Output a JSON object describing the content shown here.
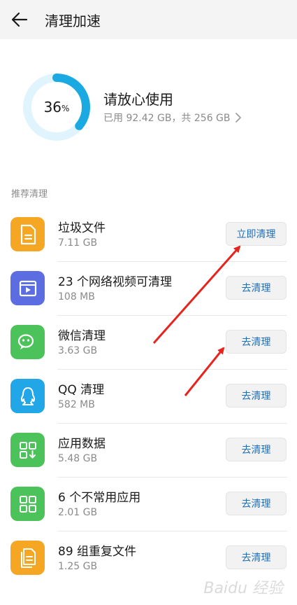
{
  "header": {
    "title": "清理加速"
  },
  "storage": {
    "percent": "36",
    "percent_symbol": "%",
    "usage_fraction": 0.36,
    "status": "请放心使用",
    "detail": "已用 92.42 GB，共 256 GB",
    "ring_color": "#1aa9e0",
    "ring_track_color": "#dff4fc"
  },
  "section": {
    "label": "推荐清理"
  },
  "items": [
    {
      "title": "垃圾文件",
      "size": "7.11 GB",
      "button": "立即清理",
      "icon": "document-icon",
      "color": "#f5a623"
    },
    {
      "title": "23 个网络视频可清理",
      "size": "108 MB",
      "button": "去清理",
      "icon": "video-icon",
      "color": "#5b6de0"
    },
    {
      "title": "微信清理",
      "size": "3.63 GB",
      "button": "去清理",
      "icon": "wechat-icon",
      "color": "#4cc25a"
    },
    {
      "title": "QQ 清理",
      "size": "582 MB",
      "button": "去清理",
      "icon": "qq-icon",
      "color": "#21a7e8"
    },
    {
      "title": "应用数据",
      "size": "5.48 GB",
      "button": "去清理",
      "icon": "app-data-icon",
      "color": "#4cc25a"
    },
    {
      "title": "6 个不常用应用",
      "size": "2.01 GB",
      "button": "去清理",
      "icon": "apps-grid-icon",
      "color": "#4cc25a"
    },
    {
      "title": "89 组重复文件",
      "size": "1.25 GB",
      "button": "去清理",
      "icon": "duplicate-files-icon",
      "color": "#f5a623"
    }
  ],
  "annotation_color": "#e8231d",
  "watermark": "Baidu 经验"
}
